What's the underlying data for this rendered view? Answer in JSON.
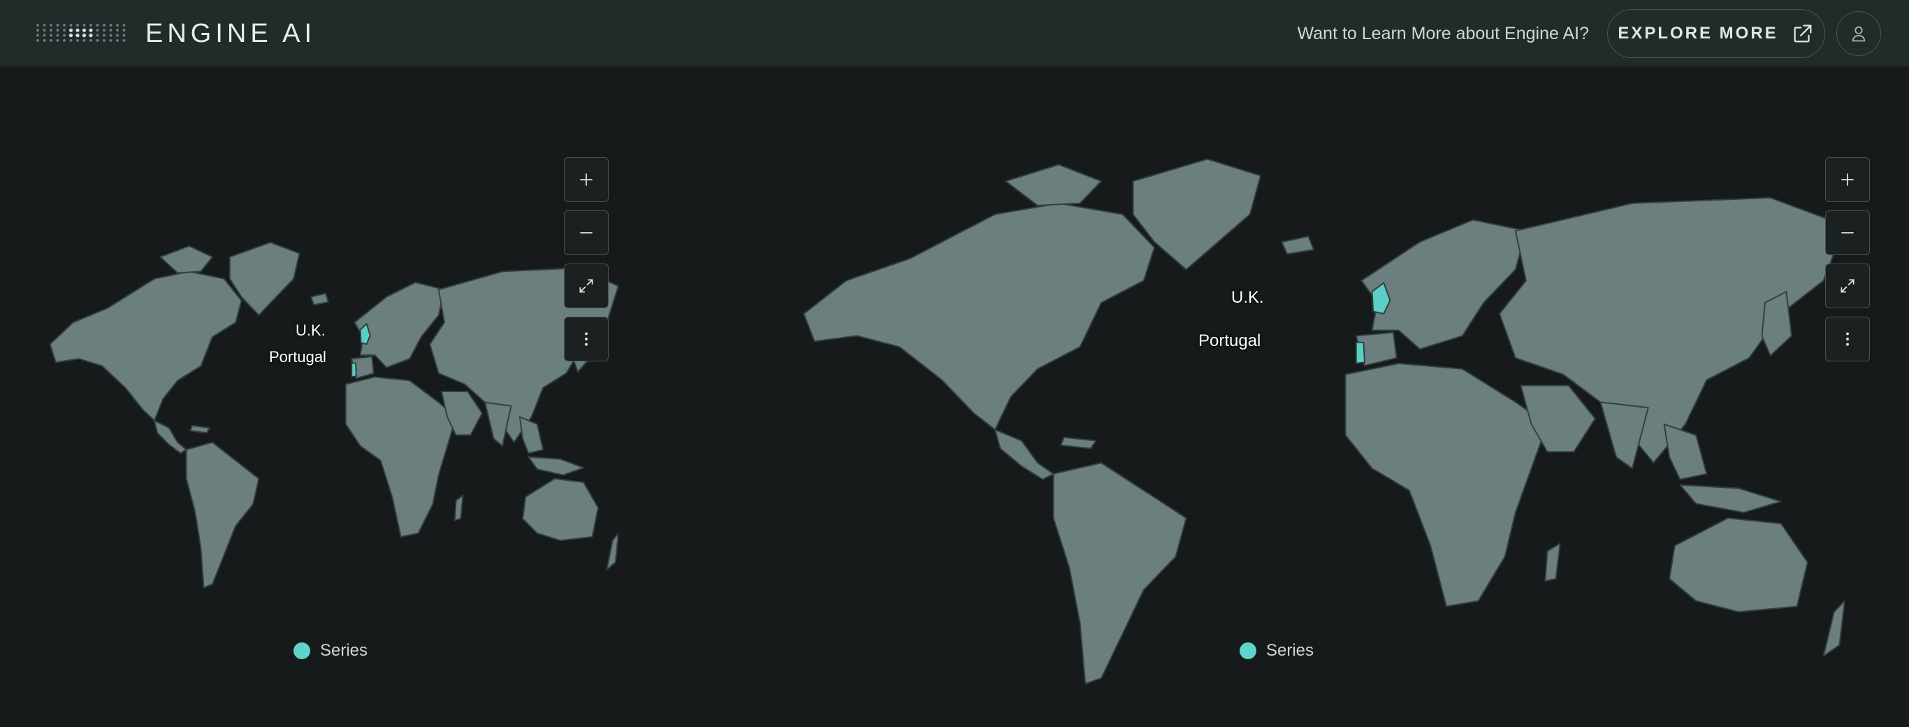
{
  "header": {
    "brand": "ENGINE AI",
    "promo_text": "Want to Learn More about Engine AI?",
    "explore_label": "EXPLORE MORE",
    "icons": {
      "logo": "dot-grid-logo",
      "explore": "external-link-icon",
      "user": "user-icon"
    }
  },
  "maps": [
    {
      "labels": {
        "uk": "U.K.",
        "portugal": "Portugal"
      },
      "highlighted": [
        "U.K.",
        "Portugal"
      ],
      "legend": {
        "label": "Series",
        "color": "#5fd4cb"
      },
      "controls": [
        "zoom-in-icon",
        "zoom-out-icon",
        "expand-icon",
        "more-vertical-icon"
      ]
    },
    {
      "labels": {
        "uk": "U.K.",
        "portugal": "Portugal"
      },
      "highlighted": [
        "U.K.",
        "Portugal"
      ],
      "legend": {
        "label": "Series",
        "color": "#5fd4cb"
      },
      "controls": [
        "zoom-in-icon",
        "zoom-out-icon",
        "expand-icon",
        "more-vertical-icon"
      ]
    }
  ],
  "colors": {
    "land": "#6b7f7f",
    "highlight": "#59cfc5",
    "background": "#161a1a",
    "header": "#232a2a"
  }
}
